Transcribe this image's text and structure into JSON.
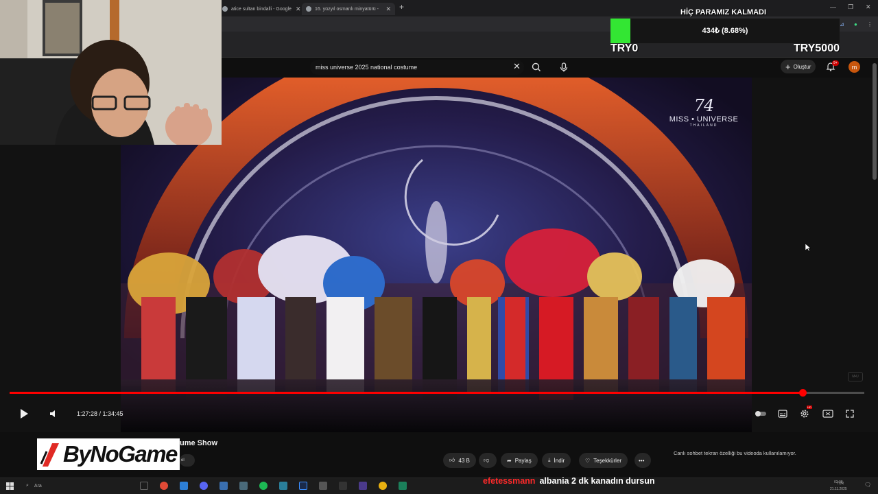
{
  "browser": {
    "tabs": [
      {
        "title": "atice sultan bindalli - Google"
      },
      {
        "title": "16. yüzyıl osmanlı minyatürü -"
      }
    ]
  },
  "youtube": {
    "search_query": "miss universe 2025 national costume",
    "create_label": "Oluştur",
    "notification_count": "9+",
    "avatar_letter": "m"
  },
  "video": {
    "watermark": {
      "number": "74",
      "name": "MISS • UNIVERSE",
      "country": "THAILAND"
    },
    "corner_mark": "M•U",
    "progress": 0.928,
    "time_current": "1:27:28",
    "time_total": "1:34:45",
    "time_display": "1:27:28 / 1:34:45",
    "hd_badge": "HD"
  },
  "below_player": {
    "title_fragment": "ume Show",
    "subscribe_fragment": "el",
    "like_count": "43 B",
    "share_label": "Paylaş",
    "download_label": "İndir",
    "thanks_label": "Teşekkürler",
    "chat_note": "Canlı sohbet tekran özelliği bu videoda kullanılamıyor."
  },
  "taskbar": {
    "search_label": "Ara",
    "lang": "TUR",
    "time": "02:08",
    "date": "21.11.2025"
  },
  "overlay": {
    "logo_text": "ByNoGame",
    "donation": {
      "title": "HİÇ PARAMIZ KALMADI",
      "amount": "434₺ (8.68%)",
      "progress": 0.0868,
      "min_label": "TRY0",
      "max_label": "TRY5000",
      "fill_color": "#33e633"
    },
    "chat": {
      "user": "efetessmann",
      "message": "albania 2 dk kanadın dursun"
    }
  }
}
